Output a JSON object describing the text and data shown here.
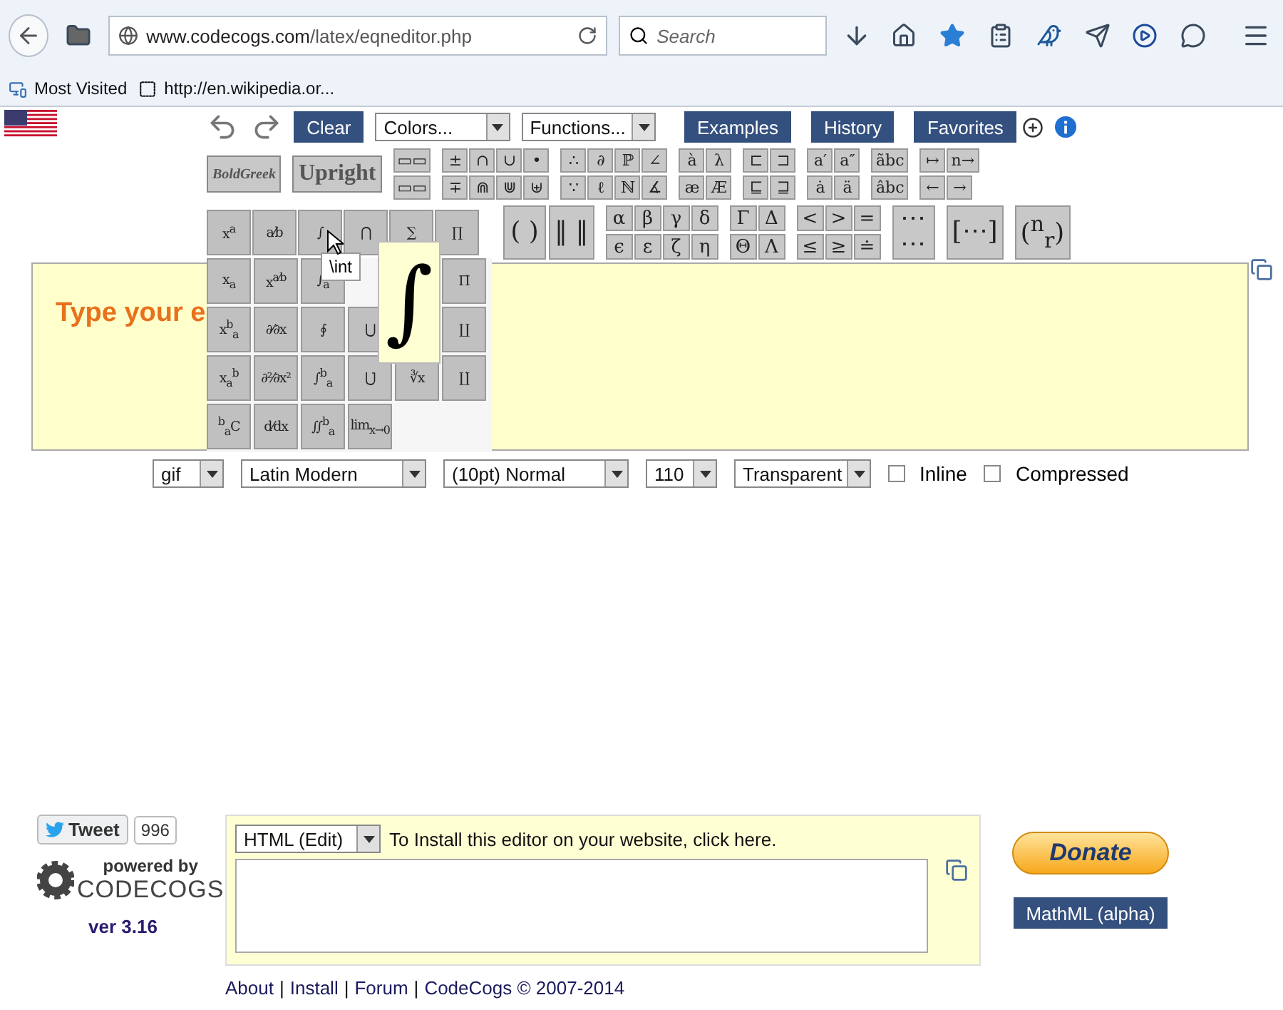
{
  "browser": {
    "url_host": "www.codecogs.com",
    "url_path": "/latex/eqneditor.php",
    "search_placeholder": "Search",
    "bookmarks": [
      {
        "label": "Most Visited",
        "kind": "folder"
      },
      {
        "label": "http://en.wikipedia.or...",
        "kind": "page"
      }
    ]
  },
  "toolbar": {
    "clear": "Clear",
    "menus": [
      "Colors...",
      "Functions..."
    ],
    "buttons": [
      "Examples",
      "History",
      "Favorites"
    ]
  },
  "styles": [
    "BoldGreek",
    "Upright"
  ],
  "small_groups": [
    [
      [
        "▭▭"
      ],
      [
        "▭▭"
      ]
    ],
    [
      [
        "±",
        "∩",
        "∪",
        "•"
      ],
      [
        "∓",
        "⋒",
        "⋓",
        "⊎"
      ]
    ],
    [
      [
        "∴",
        "∂",
        "ℙ",
        "∠"
      ],
      [
        "∵",
        "ℓ",
        "ℕ",
        "∡"
      ]
    ],
    [
      [
        "à",
        "λ"
      ],
      [
        "æ",
        "Æ"
      ]
    ],
    [
      [
        "⊏",
        "⊐"
      ],
      [
        "⊑",
        "⊒"
      ]
    ],
    [
      [
        "a′",
        "a″"
      ],
      [
        "ȧ",
        "ä"
      ]
    ],
    [
      [
        "ãbc"
      ],
      [
        "âbc"
      ]
    ],
    [
      [
        "↦",
        "n→"
      ],
      [
        "←",
        "→"
      ]
    ]
  ],
  "palette": {
    "rows": [
      [
        "x$^{a}$",
        "a⁄b",
        "∫",
        "⋂",
        "∑",
        "∏"
      ],
      [
        "x$_{a}$",
        "x$^{a⁄b}$",
        "∫$_{a}$",
        null,
        null,
        "Π̇"
      ],
      [
        "x$^{b}$$_{a}$",
        "∂⁄∂x",
        "∮",
        "⋃",
        null,
        "∐"
      ],
      [
        "x$_{a}$$^{b}$",
        "∂²⁄∂x²",
        "∫$^{b}$$_{a}$",
        "⋃̇",
        "∛x",
        "∐̇"
      ],
      [
        "$^{b}$$_{a}$C",
        "d⁄dx",
        "∬$^{b}$$_{a}$",
        "lim$_{x→0}$"
      ]
    ],
    "tooltip": "\\int",
    "preview": "∫"
  },
  "big_groups": [
    {
      "kind": "tall",
      "items": [
        "( )",
        "‖ ‖"
      ]
    },
    {
      "kind": "grid",
      "rows": [
        [
          "α",
          "β",
          "γ",
          "δ"
        ],
        [
          "ϵ",
          "ε",
          "ζ",
          "η"
        ]
      ]
    },
    {
      "kind": "grid",
      "rows": [
        [
          "Γ",
          "Δ"
        ],
        [
          "Θ",
          "Λ"
        ]
      ]
    },
    {
      "kind": "grid",
      "rows": [
        [
          "<",
          ">",
          "="
        ],
        [
          "≤",
          "≥",
          "≐"
        ]
      ]
    },
    {
      "kind": "tall",
      "items": [
        "⋯\n⋯"
      ]
    },
    {
      "kind": "tall",
      "items": [
        "[⋯]"
      ]
    },
    {
      "kind": "tall",
      "items": [
        "($^{n}$$_{r}$)"
      ]
    }
  ],
  "editor": {
    "text": "Type your e"
  },
  "options": {
    "selects": [
      "gif",
      "Latin Modern",
      "(10pt) Normal",
      "110",
      "Transparent"
    ],
    "checkboxes": [
      {
        "label": "Inline",
        "checked": false
      },
      {
        "label": "Compressed",
        "checked": false
      }
    ]
  },
  "footer": {
    "tweet": "Tweet",
    "tweet_count": "996",
    "powered_by": "powered by",
    "brand": "CODECOGS",
    "version": "ver 3.16",
    "format": "HTML (Edit)",
    "install_text": "To Install this editor on your website, ",
    "install_link": "click here.",
    "donate": "Donate",
    "mathml": "MathML (alpha)",
    "links": [
      "About",
      "Install",
      "Forum",
      "CodeCogs © 2007-2014"
    ],
    "separator": "|"
  }
}
